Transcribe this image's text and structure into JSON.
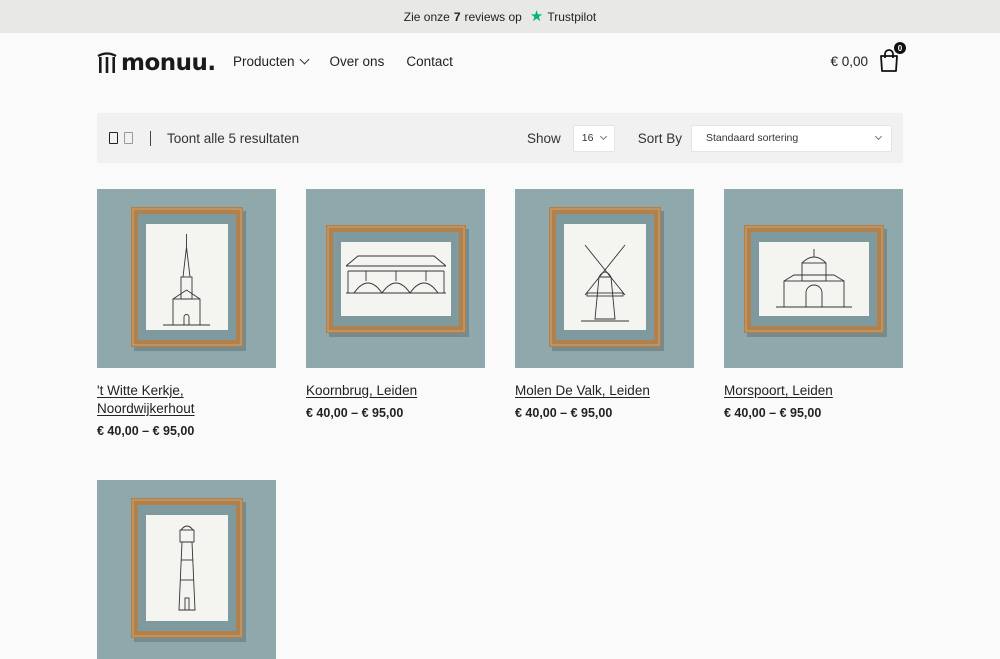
{
  "topbar": {
    "prefix": "Zie onze",
    "count": "7",
    "suffix": "reviews op",
    "brand": "Trustpilot"
  },
  "header": {
    "logo": "monuu.",
    "nav": [
      {
        "label": "Producten",
        "has_dropdown": true
      },
      {
        "label": "Over ons",
        "has_dropdown": false
      },
      {
        "label": "Contact",
        "has_dropdown": false
      }
    ],
    "cart_total": "€ 0,00",
    "cart_count": "0"
  },
  "toolbar": {
    "result_count": "Toont alle 5 resultaten",
    "show_label": "Show",
    "show_value": "16",
    "sort_label": "Sort By",
    "sort_value": "Standaard sortering"
  },
  "products": [
    {
      "title_line1": "'t Witte Kerkje,",
      "title_line2": "Noordwijkerhout",
      "price": "€ 40,00 – € 95,00",
      "drawing": "church"
    },
    {
      "title_line1": "Koornbrug, Leiden",
      "title_line2": "",
      "price": "€ 40,00 – € 95,00",
      "drawing": "bridge"
    },
    {
      "title_line1": "Molen De Valk, Leiden",
      "title_line2": "",
      "price": "€ 40,00 – € 95,00",
      "drawing": "windmill"
    },
    {
      "title_line1": "Morspoort, Leiden",
      "title_line2": "",
      "price": "€ 40,00 – € 95,00",
      "drawing": "gate"
    },
    {
      "title_line1": "",
      "title_line2": "",
      "price": "",
      "drawing": "lighthouse"
    }
  ],
  "colors": {
    "wall": "#8fa8ac",
    "frame": "#b0814d",
    "paper": "#f4f4f1",
    "accent": "#00b67a"
  }
}
